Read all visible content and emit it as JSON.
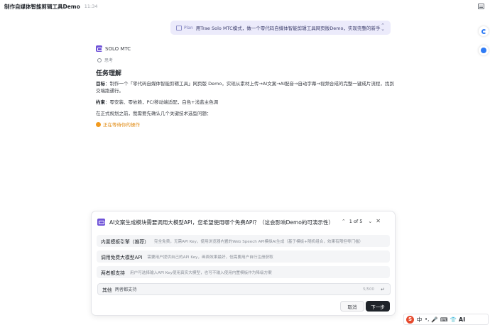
{
  "window": {
    "title": "制作自媒体智能剪辑工具Demo",
    "time": "11:34"
  },
  "plan": {
    "tag": "Plan",
    "text": "用Trae Solo MTC模式，做一个零代码自媒体智能剪辑工具网页版Demo，实现完整的新手"
  },
  "agent": {
    "name": "SOLO MTC",
    "thinking_label": "思考"
  },
  "content": {
    "section_title": "任务理解",
    "goal_label": "目标",
    "goal_text": "：制作一个「零代码自媒体智能剪辑工具」网页版 Demo，实现从素材上传→AI文案→AI配音→自动字幕→视频合成的完整一键成片流程，找到交端跑通行。",
    "constraint_label": "约束",
    "constraint_text": "：零安装、零依赖，PC/移动端适配，白色+浅蓝主色调",
    "before_text": "在正式规划之前，我需要先确认几个关键技术选型问题：",
    "waiting_text": "正在等待你的操作"
  },
  "question": {
    "text": "AI文案生成模块需要调用大模型API，您希望使用哪个免费API？（这会影响Demo的可演示性）",
    "pager": "1 of 5",
    "options": [
      {
        "label": "内置模板引擎（推荐）",
        "desc": "完全免费，无需API Key，使用浏览器内置的Web Speech API模拟AI生成（基于模板+随机组合，效果有限但零门槛）"
      },
      {
        "label": "调用免费大模型API",
        "desc": "需要用户提供自己的API Key，画面效果最好，但需要用户自行注册获取"
      },
      {
        "label": "两者都支持",
        "desc": "用户可选择输入API Key使用真实大模型，也可不输入使用内置模板作为降级方案"
      }
    ],
    "other_label": "其他",
    "other_value": "两者都支持",
    "char_count": "5/500",
    "cancel_label": "取消",
    "next_label": "下一步"
  },
  "ime": {
    "logo": "S",
    "items": [
      "中",
      "•,",
      "🎤",
      "⌨",
      "👕",
      "AI"
    ]
  },
  "colors": {
    "accent": "#6f53d8",
    "plan_bg": "#ecebfb",
    "waiting": "#e08a12",
    "primary_button": "#1f2329"
  },
  "icons": {
    "agent": "solo-logo-icon",
    "thinking": "thinking-icon",
    "waiting": "waiting-icon",
    "float_a": "assistant-icon",
    "float_b": "bubble-icon"
  }
}
